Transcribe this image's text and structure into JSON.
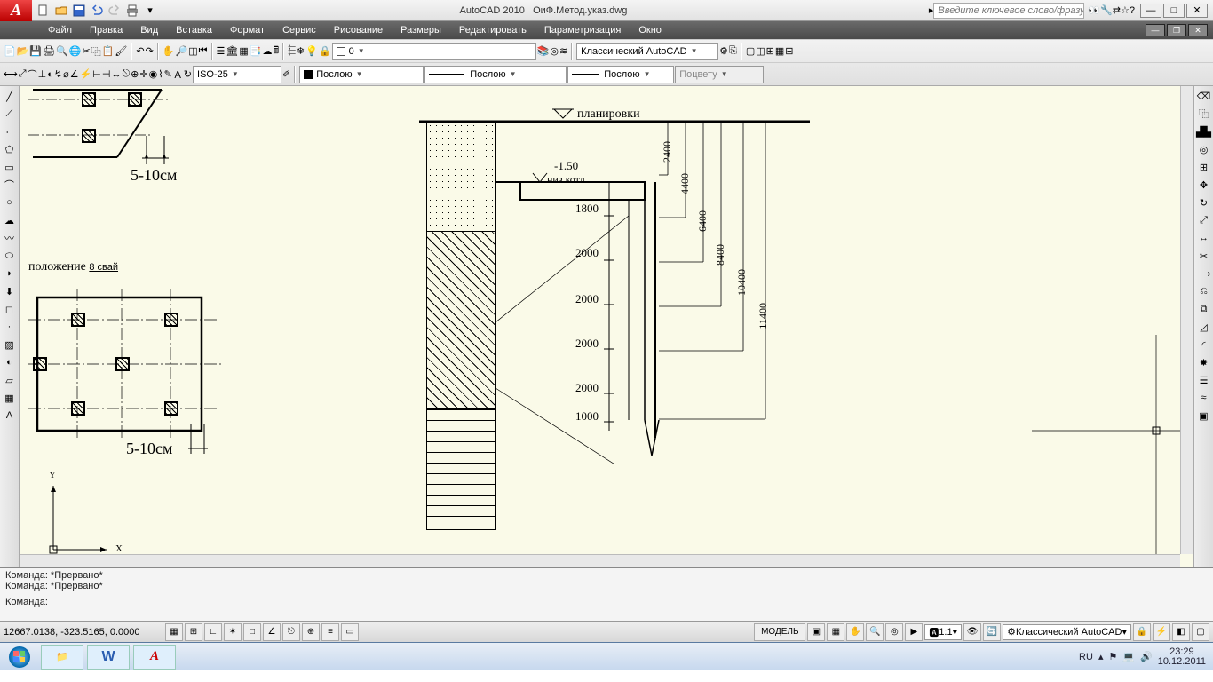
{
  "title": {
    "app": "AutoCAD 2010",
    "file": "ОиФ.Метод.указ.dwg"
  },
  "search_placeholder": "Введите ключевое слово/фразу",
  "menu": [
    "Файл",
    "Правка",
    "Вид",
    "Вставка",
    "Формат",
    "Сервис",
    "Рисование",
    "Размеры",
    "Редактировать",
    "Параметризация",
    "Окно"
  ],
  "toolbar": {
    "layer": "0",
    "dimstyle": "ISO-25",
    "ltype": "Послою",
    "lweight": "Послою",
    "color": "Послою",
    "workspace": "Классический AutoCAD",
    "bycolor": "Поцвету"
  },
  "drawing": {
    "layer_label": "планировки",
    "elev": "-1.50",
    "pit_bottom": "низ котл.",
    "dims_v": [
      "2400",
      "4400",
      "6400",
      "8400",
      "10400",
      "11400"
    ],
    "dims_h": [
      "1800",
      "2000",
      "2000",
      "2000",
      "2000",
      "1000"
    ],
    "plan_text": "положение 8 свай",
    "plan_text_u": "8 свай",
    "spacing": "5-10см",
    "axes": {
      "x": "X",
      "y": "Y"
    }
  },
  "command": {
    "line1": "Команда: *Прервано*",
    "line2": "Команда: *Прервано*",
    "prompt": "Команда:"
  },
  "status": {
    "coords": "12667.0138, -323.5165, 0.0000",
    "model": "МОДЕЛЬ",
    "scale": "1:1",
    "ws": "Классический AutoCAD"
  },
  "tray": {
    "lang": "RU",
    "time": "23:29",
    "date": "10.12.2011"
  }
}
